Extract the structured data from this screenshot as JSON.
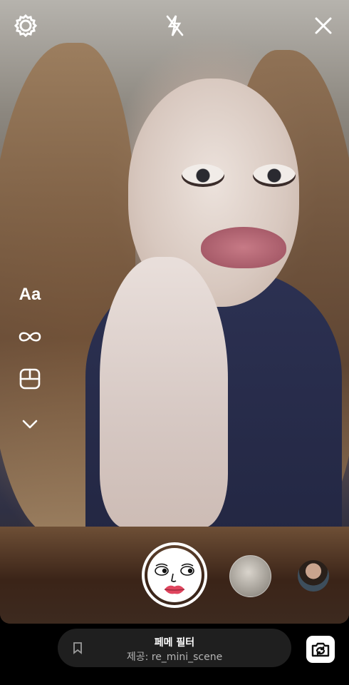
{
  "camera": {
    "top_controls": [
      {
        "name": "settings",
        "icon": "settings-icon"
      },
      {
        "name": "flash",
        "icon": "flash-off-icon"
      },
      {
        "name": "close",
        "icon": "close-icon"
      }
    ],
    "tools": {
      "text_label": "Aa",
      "boomerang_icon": "infinity-icon",
      "layout_icon": "layout-icon",
      "more_icon": "chevron-down-icon"
    }
  },
  "effects": {
    "selected_icon": "face-filter-icon",
    "others": [
      "effect-thumbnail-1",
      "effect-thumbnail-2"
    ]
  },
  "filter": {
    "name": "페메 필터",
    "source": "제공: re_mini_scene",
    "bookmark_icon": "bookmark-icon",
    "flip_icon": "flip-camera-icon"
  }
}
